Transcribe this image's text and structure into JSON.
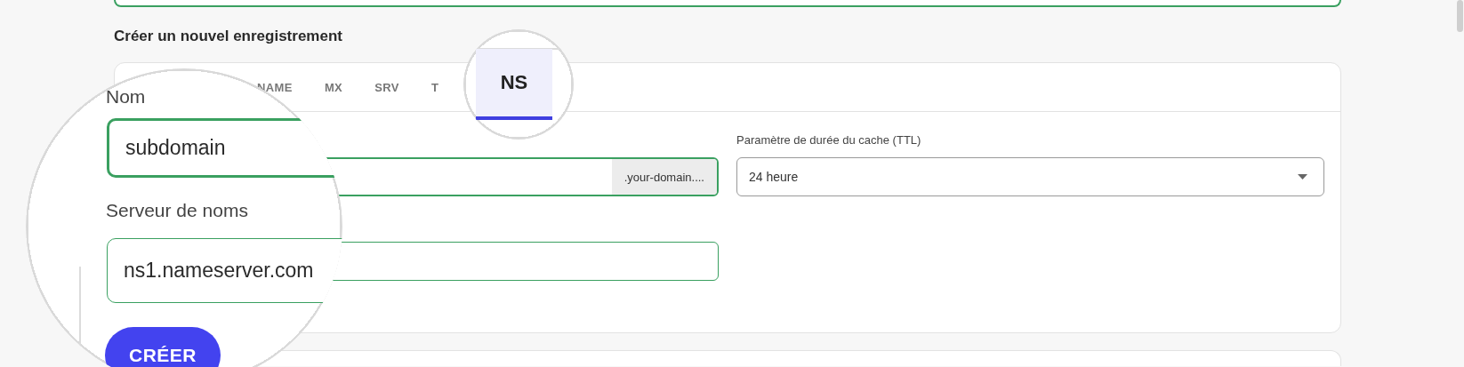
{
  "heading": "Créer un nouvel enregistrement",
  "tabs": [
    {
      "label": "NAME",
      "selected": false
    },
    {
      "label": "MX",
      "selected": false
    },
    {
      "label": "SRV",
      "selected": false
    },
    {
      "label": "T",
      "selected": false
    },
    {
      "label": "NS",
      "selected": true
    }
  ],
  "name_field": {
    "label": "Nom",
    "value": "subdomain",
    "suffix": ".your-domain...."
  },
  "ttl_field": {
    "label": "Paramètre de durée du cache (TTL)",
    "value": "24 heure"
  },
  "nameserver_field": {
    "label": "Serveur de noms",
    "value": "ns1.nameserver.com"
  },
  "create_button": "CRÉER"
}
